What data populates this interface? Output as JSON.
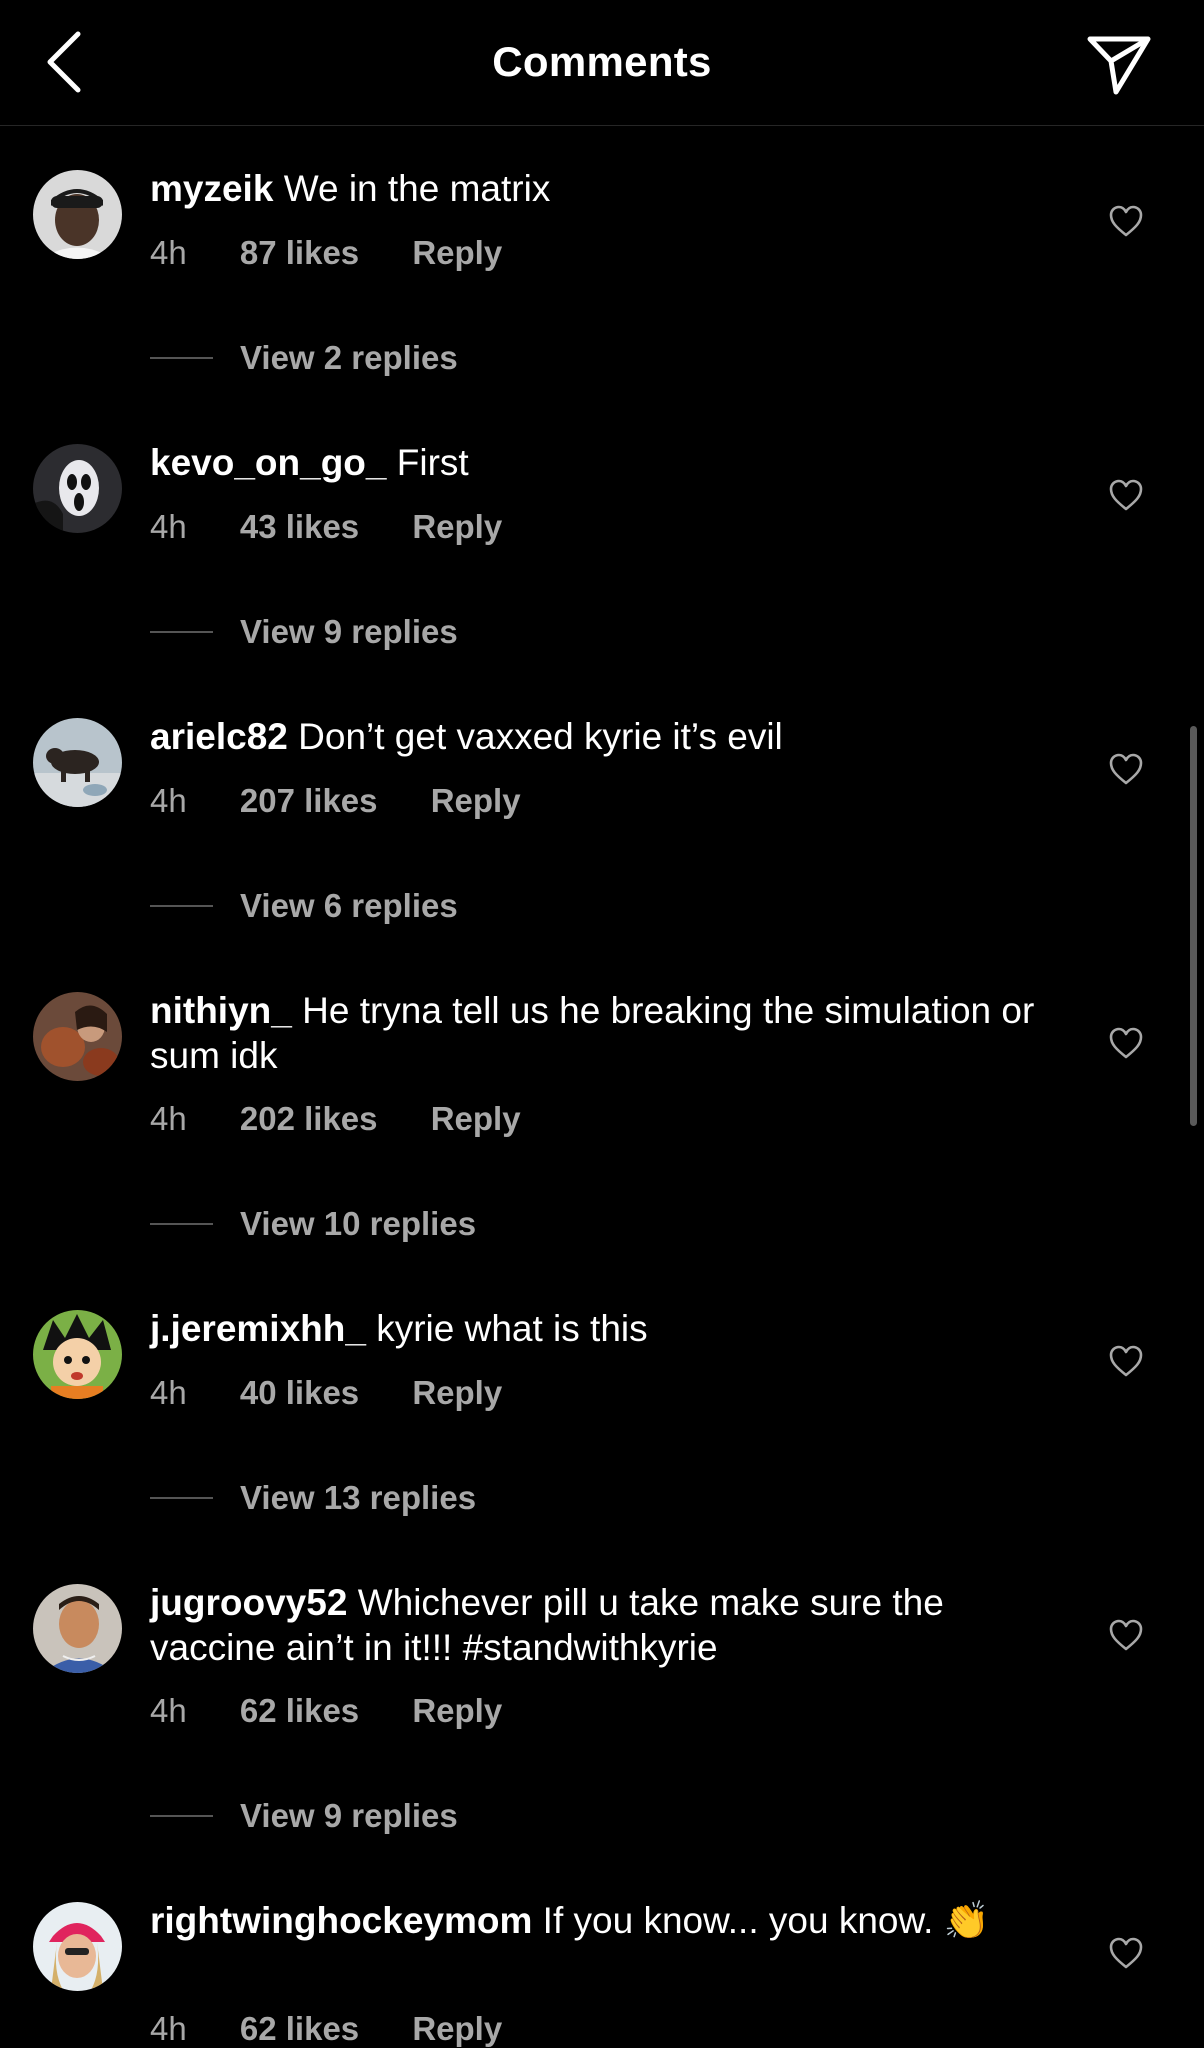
{
  "header": {
    "title": "Comments",
    "back_icon": "chevron-left-icon",
    "share_icon": "paper-plane-icon"
  },
  "colors": {
    "background": "#000000",
    "text": "#ffffff",
    "secondary_text": "#a8a8a8"
  },
  "comments": [
    {
      "username": "myzeik",
      "text": "We in the matrix",
      "time": "4h",
      "likes": "87 likes",
      "reply": "Reply",
      "view_replies": "View 2 replies"
    },
    {
      "username": "kevo_on_go_",
      "text": "First",
      "time": "4h",
      "likes": "43 likes",
      "reply": "Reply",
      "view_replies": "View 9 replies"
    },
    {
      "username": "arielc82",
      "text": "Don’t get vaxxed kyrie it’s evil",
      "time": "4h",
      "likes": "207 likes",
      "reply": "Reply",
      "view_replies": "View 6 replies"
    },
    {
      "username": "nithiyn_",
      "text": "He tryna tell us he breaking the simulation or sum idk",
      "time": "4h",
      "likes": "202 likes",
      "reply": "Reply",
      "view_replies": "View 10 replies"
    },
    {
      "username": "j.jeremixhh_",
      "text": "kyrie what is this",
      "time": "4h",
      "likes": "40 likes",
      "reply": "Reply",
      "view_replies": "View 13 replies"
    },
    {
      "username": "jugroovy52",
      "text": "Whichever pill u take make sure the vaccine ain’t in it!!! #standwithkyrie",
      "time": "4h",
      "likes": "62 likes",
      "reply": "Reply",
      "view_replies": "View 9 replies"
    },
    {
      "username": "rightwinghockeymom",
      "text": "If you know... you know. 👏",
      "time": "4h",
      "likes": "62 likes",
      "reply": "Reply",
      "view_replies": ""
    }
  ]
}
